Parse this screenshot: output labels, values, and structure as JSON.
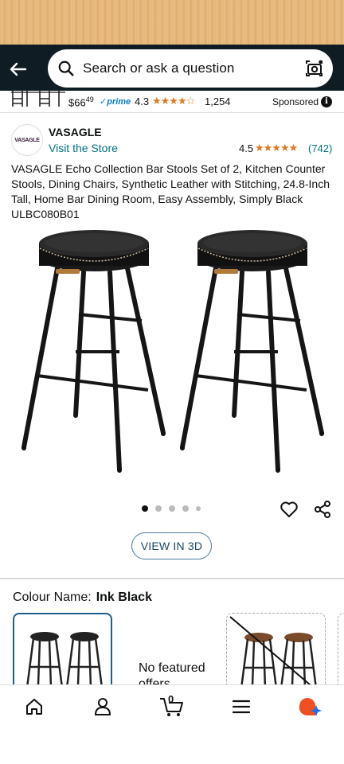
{
  "search": {
    "placeholder": "Search or ask a question"
  },
  "sponsored_strip": {
    "price_whole": "$66",
    "price_fraction": "49",
    "prime": "prime",
    "rating": "4.3",
    "stars": "★★★★☆",
    "rating_count": "1,254",
    "label": "Sponsored"
  },
  "brand": {
    "logo_text": "VASAGLE",
    "name": "VASAGLE",
    "visit_store": "Visit the Store",
    "rating": "4.5",
    "stars": "★★★★★",
    "rating_count": "(742)"
  },
  "product": {
    "title": "VASAGLE Echo Collection Bar Stools Set of 2, Kitchen Counter Stools, Dining Chairs, Synthetic Leather with Stitching, 24.8-Inch Tall, Home Bar Dining Room, Easy Assembly, Simply Black ULBC080B01",
    "image_count": 5,
    "current_image": 1,
    "view3d_label": "VIEW IN 3D"
  },
  "colour": {
    "label": "Colour Name:",
    "value": "Ink Black",
    "no_featured": "No featured offers"
  },
  "cart": {
    "count": "0"
  },
  "colors": {
    "header_bg": "#0f1c24",
    "star": "#de7921",
    "link": "#007185",
    "prime": "#0a7bc8",
    "selected_border": "#1f5e8c"
  },
  "icons": [
    "back-arrow-icon",
    "search-icon",
    "camera-lens-icon",
    "info-icon",
    "heart-icon",
    "share-icon",
    "home-icon",
    "account-icon",
    "cart-icon",
    "menu-icon",
    "rufus-icon"
  ]
}
